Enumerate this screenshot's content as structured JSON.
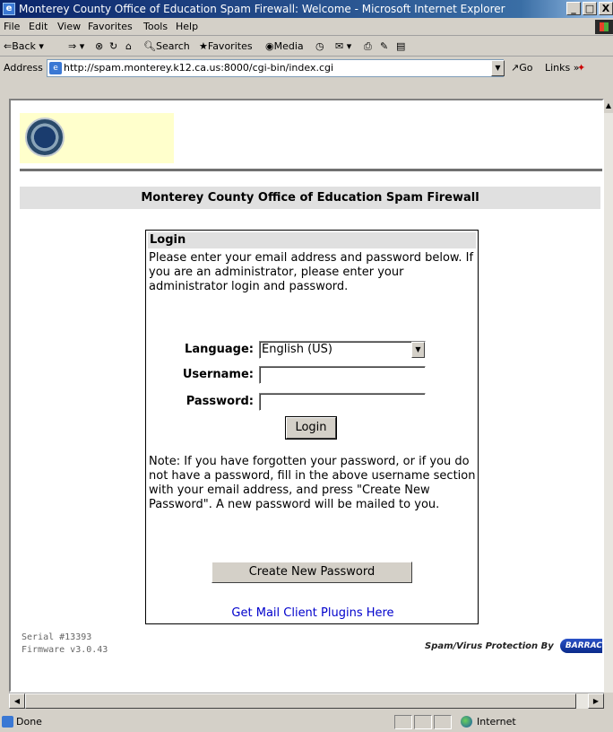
{
  "window": {
    "title": "Monterey County Office of Education Spam Firewall: Welcome - Microsoft Internet Explorer",
    "title_icon": "ie-icon",
    "minimize_label": "_",
    "maximize_label": "□",
    "close_label": "X"
  },
  "menu": [
    "File",
    "Edit",
    "View",
    "Favorites",
    "Tools",
    "Help"
  ],
  "toolbar": {
    "back": "Back",
    "search": "Search",
    "favorites": "Favorites",
    "media": "Media"
  },
  "address": {
    "label": "Address",
    "url": "http://spam.monterey.k12.ca.us:8000/cgi-bin/index.cgi",
    "go": "Go",
    "links": "Links"
  },
  "page": {
    "heading": "Monterey County Office of Education Spam Firewall",
    "login_header": "Login",
    "intro": "Please enter your email address and password below. If you are an administrator, please enter your administrator login and password.",
    "language_label": "Language:",
    "language_value": "English (US)",
    "username_label": "Username:",
    "username_value": "",
    "password_label": "Password:",
    "password_value": "",
    "login_button": "Login",
    "note": "Note: If you have forgotten your password, or if you do not have a password, fill in the above username section with your email address, and press \"Create New Password\". A new password will be mailed to you.",
    "create_password_button": "Create New Password",
    "plugins_link": "Get Mail Client Plugins Here",
    "serial": "Serial #13393",
    "firmware": "Firmware v3.0.43",
    "powered_by": "Spam/Virus Protection By",
    "brand": "BARRACUDA"
  },
  "status": {
    "text": "Done",
    "zone": "Internet"
  },
  "colors": {
    "title_gradient_start": "#0a246a",
    "link": "#0000cc",
    "logo_bg": "#ffffcc"
  }
}
